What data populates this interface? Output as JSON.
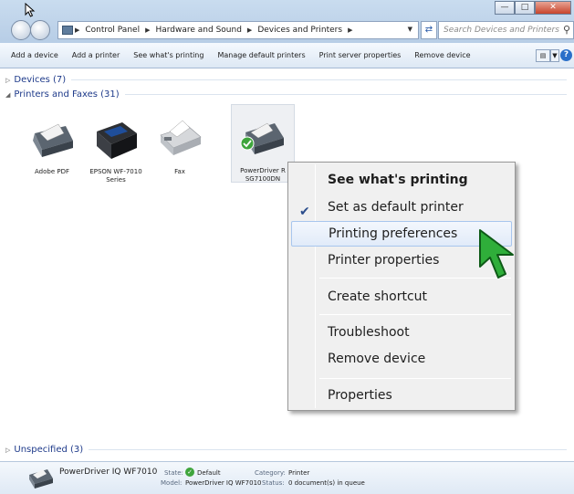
{
  "address_bar": {
    "crumbs": [
      "Control Panel",
      "Hardware and Sound",
      "Devices and Printers"
    ],
    "search_placeholder": "Search Devices and Printers"
  },
  "toolbar": {
    "items": [
      "Add a device",
      "Add a printer",
      "See what's printing",
      "Manage default printers",
      "Print server properties",
      "Remove device"
    ]
  },
  "groups": {
    "devices": "Devices (7)",
    "printers": "Printers and Faxes (31)",
    "unspecified": "Unspecified (3)"
  },
  "printers": [
    {
      "line1": "Adobe PDF",
      "line2": ""
    },
    {
      "line1": "EPSON WF-7010",
      "line2": "Series"
    },
    {
      "line1": "Fax",
      "line2": ""
    },
    {
      "line1": "PowerDriver R",
      "line2": "SG7100DN"
    }
  ],
  "context_menu": {
    "items": [
      "See what's printing",
      "Set as default printer",
      "Printing preferences",
      "Printer properties",
      "Create shortcut",
      "Troubleshoot",
      "Remove device",
      "Properties"
    ]
  },
  "details": {
    "name": "PowerDriver IQ WF7010",
    "state_label": "State:",
    "state_value": "Default",
    "model_label": "Model:",
    "model_value": "PowerDriver IQ WF7010",
    "category_label": "Category:",
    "category_value": "Printer",
    "status_label": "Status:",
    "status_value": "0 document(s) in queue"
  }
}
